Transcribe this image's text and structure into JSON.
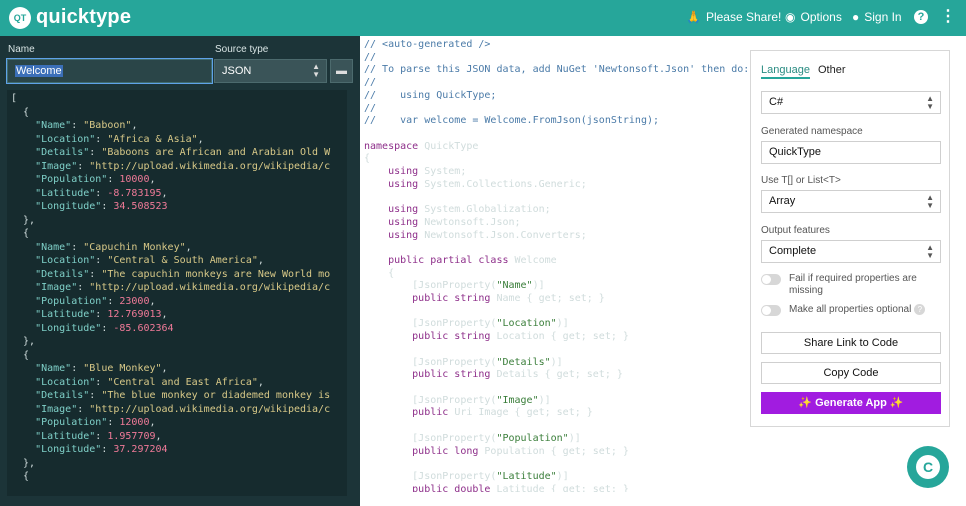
{
  "header": {
    "logo_text": "QT",
    "brand": "quicktype",
    "share": "Please Share!",
    "options": "Options",
    "sign_in": "Sign In",
    "help": "?",
    "more": "⋮"
  },
  "left": {
    "name_label": "Name",
    "name_value": "Welcome",
    "source_label": "Source type",
    "source_value": "JSON"
  },
  "json_lines": [
    [
      {
        "t": "[",
        "c": "p"
      }
    ],
    [
      {
        "t": "  {",
        "c": "p"
      }
    ],
    [
      {
        "t": "    \"Name\"",
        "c": "k"
      },
      {
        "t": ": ",
        "c": "p"
      },
      {
        "t": "\"Baboon\"",
        "c": "s"
      },
      {
        "t": ",",
        "c": "p"
      }
    ],
    [
      {
        "t": "    \"Location\"",
        "c": "k"
      },
      {
        "t": ": ",
        "c": "p"
      },
      {
        "t": "\"Africa & Asia\"",
        "c": "s"
      },
      {
        "t": ",",
        "c": "p"
      }
    ],
    [
      {
        "t": "    \"Details\"",
        "c": "k"
      },
      {
        "t": ": ",
        "c": "p"
      },
      {
        "t": "\"Baboons are African and Arabian Old W",
        "c": "s"
      }
    ],
    [
      {
        "t": "    \"Image\"",
        "c": "k"
      },
      {
        "t": ": ",
        "c": "p"
      },
      {
        "t": "\"http://upload.wikimedia.org/wikipedia/c",
        "c": "s"
      }
    ],
    [
      {
        "t": "    \"Population\"",
        "c": "k"
      },
      {
        "t": ": ",
        "c": "p"
      },
      {
        "t": "10000",
        "c": "n"
      },
      {
        "t": ",",
        "c": "p"
      }
    ],
    [
      {
        "t": "    \"Latitude\"",
        "c": "k"
      },
      {
        "t": ": ",
        "c": "p"
      },
      {
        "t": "-8.783195",
        "c": "n"
      },
      {
        "t": ",",
        "c": "p"
      }
    ],
    [
      {
        "t": "    \"Longitude\"",
        "c": "k"
      },
      {
        "t": ": ",
        "c": "p"
      },
      {
        "t": "34.508523",
        "c": "n"
      }
    ],
    [
      {
        "t": "  },",
        "c": "p"
      }
    ],
    [
      {
        "t": "  {",
        "c": "p"
      }
    ],
    [
      {
        "t": "    \"Name\"",
        "c": "k"
      },
      {
        "t": ": ",
        "c": "p"
      },
      {
        "t": "\"Capuchin Monkey\"",
        "c": "s"
      },
      {
        "t": ",",
        "c": "p"
      }
    ],
    [
      {
        "t": "    \"Location\"",
        "c": "k"
      },
      {
        "t": ": ",
        "c": "p"
      },
      {
        "t": "\"Central & South America\"",
        "c": "s"
      },
      {
        "t": ",",
        "c": "p"
      }
    ],
    [
      {
        "t": "    \"Details\"",
        "c": "k"
      },
      {
        "t": ": ",
        "c": "p"
      },
      {
        "t": "\"The capuchin monkeys are New World mo",
        "c": "s"
      }
    ],
    [
      {
        "t": "    \"Image\"",
        "c": "k"
      },
      {
        "t": ": ",
        "c": "p"
      },
      {
        "t": "\"http://upload.wikimedia.org/wikipedia/c",
        "c": "s"
      }
    ],
    [
      {
        "t": "    \"Population\"",
        "c": "k"
      },
      {
        "t": ": ",
        "c": "p"
      },
      {
        "t": "23000",
        "c": "n"
      },
      {
        "t": ",",
        "c": "p"
      }
    ],
    [
      {
        "t": "    \"Latitude\"",
        "c": "k"
      },
      {
        "t": ": ",
        "c": "p"
      },
      {
        "t": "12.769013",
        "c": "n"
      },
      {
        "t": ",",
        "c": "p"
      }
    ],
    [
      {
        "t": "    \"Longitude\"",
        "c": "k"
      },
      {
        "t": ": ",
        "c": "p"
      },
      {
        "t": "-85.602364",
        "c": "n"
      }
    ],
    [
      {
        "t": "  },",
        "c": "p"
      }
    ],
    [
      {
        "t": "  {",
        "c": "p"
      }
    ],
    [
      {
        "t": "    \"Name\"",
        "c": "k"
      },
      {
        "t": ": ",
        "c": "p"
      },
      {
        "t": "\"Blue Monkey\"",
        "c": "s"
      },
      {
        "t": ",",
        "c": "p"
      }
    ],
    [
      {
        "t": "    \"Location\"",
        "c": "k"
      },
      {
        "t": ": ",
        "c": "p"
      },
      {
        "t": "\"Central and East Africa\"",
        "c": "s"
      },
      {
        "t": ",",
        "c": "p"
      }
    ],
    [
      {
        "t": "    \"Details\"",
        "c": "k"
      },
      {
        "t": ": ",
        "c": "p"
      },
      {
        "t": "\"The blue monkey or diademed monkey is",
        "c": "s"
      }
    ],
    [
      {
        "t": "    \"Image\"",
        "c": "k"
      },
      {
        "t": ": ",
        "c": "p"
      },
      {
        "t": "\"http://upload.wikimedia.org/wikipedia/c",
        "c": "s"
      }
    ],
    [
      {
        "t": "    \"Population\"",
        "c": "k"
      },
      {
        "t": ": ",
        "c": "p"
      },
      {
        "t": "12000",
        "c": "n"
      },
      {
        "t": ",",
        "c": "p"
      }
    ],
    [
      {
        "t": "    \"Latitude\"",
        "c": "k"
      },
      {
        "t": ": ",
        "c": "p"
      },
      {
        "t": "1.957709",
        "c": "n"
      },
      {
        "t": ",",
        "c": "p"
      }
    ],
    [
      {
        "t": "    \"Longitude\"",
        "c": "k"
      },
      {
        "t": ": ",
        "c": "p"
      },
      {
        "t": "37.297204",
        "c": "n"
      }
    ],
    [
      {
        "t": "  },",
        "c": "p"
      }
    ],
    [
      {
        "t": "  {",
        "c": "p"
      }
    ]
  ],
  "code_lines": [
    [
      {
        "t": "// <auto-generated />",
        "c": "c"
      }
    ],
    [
      {
        "t": "//",
        "c": "c"
      }
    ],
    [
      {
        "t": "// To parse this JSON data, add NuGet 'Newtonsoft.Json' then do:",
        "c": "c"
      }
    ],
    [
      {
        "t": "//",
        "c": "c"
      }
    ],
    [
      {
        "t": "//    using QuickType;",
        "c": "c"
      }
    ],
    [
      {
        "t": "//",
        "c": "c"
      }
    ],
    [
      {
        "t": "//    var welcome = Welcome.FromJson(jsonString);",
        "c": "c"
      }
    ],
    [
      {
        "t": "",
        "c": "p"
      }
    ],
    [
      {
        "t": "namespace",
        "c": "kw"
      },
      {
        "t": " QuickType",
        "c": "p"
      }
    ],
    [
      {
        "t": "{",
        "c": "p"
      }
    ],
    [
      {
        "t": "    using",
        "c": "kw"
      },
      {
        "t": " System;",
        "c": "p"
      }
    ],
    [
      {
        "t": "    using",
        "c": "kw"
      },
      {
        "t": " System.Collections.Generic;",
        "c": "p"
      }
    ],
    [
      {
        "t": "",
        "c": "p"
      }
    ],
    [
      {
        "t": "    using",
        "c": "kw"
      },
      {
        "t": " System.Globalization;",
        "c": "p"
      }
    ],
    [
      {
        "t": "    using",
        "c": "kw"
      },
      {
        "t": " Newtonsoft.Json;",
        "c": "p"
      }
    ],
    [
      {
        "t": "    using",
        "c": "kw"
      },
      {
        "t": " Newtonsoft.Json.Converters;",
        "c": "p"
      }
    ],
    [
      {
        "t": "",
        "c": "p"
      }
    ],
    [
      {
        "t": "    public partial class",
        "c": "kw"
      },
      {
        "t": " Welcome",
        "c": "p"
      }
    ],
    [
      {
        "t": "    {",
        "c": "p"
      }
    ],
    [
      {
        "t": "        [JsonProperty(",
        "c": "p"
      },
      {
        "t": "\"Name\"",
        "c": "st"
      },
      {
        "t": ")]",
        "c": "p"
      }
    ],
    [
      {
        "t": "        public string",
        "c": "kw"
      },
      {
        "t": " Name { get; set; }",
        "c": "p"
      }
    ],
    [
      {
        "t": "",
        "c": "p"
      }
    ],
    [
      {
        "t": "        [JsonProperty(",
        "c": "p"
      },
      {
        "t": "\"Location\"",
        "c": "st"
      },
      {
        "t": ")]",
        "c": "p"
      }
    ],
    [
      {
        "t": "        public string",
        "c": "kw"
      },
      {
        "t": " Location { get; set; }",
        "c": "p"
      }
    ],
    [
      {
        "t": "",
        "c": "p"
      }
    ],
    [
      {
        "t": "        [JsonProperty(",
        "c": "p"
      },
      {
        "t": "\"Details\"",
        "c": "st"
      },
      {
        "t": ")]",
        "c": "p"
      }
    ],
    [
      {
        "t": "        public string",
        "c": "kw"
      },
      {
        "t": " Details { get; set; }",
        "c": "p"
      }
    ],
    [
      {
        "t": "",
        "c": "p"
      }
    ],
    [
      {
        "t": "        [JsonProperty(",
        "c": "p"
      },
      {
        "t": "\"Image\"",
        "c": "st"
      },
      {
        "t": ")]",
        "c": "p"
      }
    ],
    [
      {
        "t": "        public",
        "c": "kw"
      },
      {
        "t": " Uri Image { get; set; }",
        "c": "p"
      }
    ],
    [
      {
        "t": "",
        "c": "p"
      }
    ],
    [
      {
        "t": "        [JsonProperty(",
        "c": "p"
      },
      {
        "t": "\"Population\"",
        "c": "st"
      },
      {
        "t": ")]",
        "c": "p"
      }
    ],
    [
      {
        "t": "        public long",
        "c": "kw"
      },
      {
        "t": " Population { get; set; }",
        "c": "p"
      }
    ],
    [
      {
        "t": "",
        "c": "p"
      }
    ],
    [
      {
        "t": "        [JsonProperty(",
        "c": "p"
      },
      {
        "t": "\"Latitude\"",
        "c": "st"
      },
      {
        "t": ")]",
        "c": "p"
      }
    ],
    [
      {
        "t": "        public double",
        "c": "kw"
      },
      {
        "t": " Latitude { get; set; }",
        "c": "p"
      }
    ]
  ],
  "settings": {
    "tab_language": "Language",
    "tab_other": "Other",
    "language": "C#",
    "namespace_label": "Generated namespace",
    "namespace_value": "QuickType",
    "array_label": "Use T[] or List<T>",
    "array_value": "Array",
    "features_label": "Output features",
    "features_value": "Complete",
    "fail_required": "Fail if required properties are missing",
    "all_optional": "Make all properties optional",
    "share_link": "Share Link to Code",
    "copy_code": "Copy Code",
    "generate_app": "✨ Generate App ✨"
  },
  "colors": {
    "accent": "#26a69a",
    "dark_bg": "#1c3438",
    "generate": "#a11ce0"
  }
}
